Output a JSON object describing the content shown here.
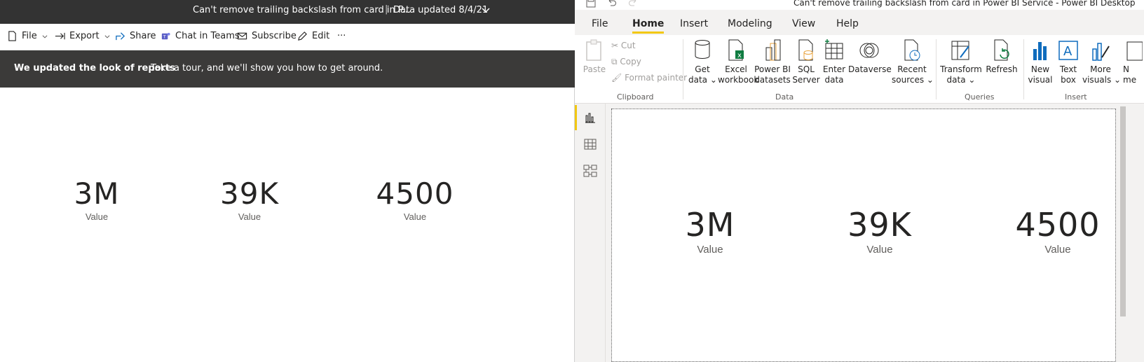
{
  "service": {
    "title_bar": {
      "title": "Can't remove trailing backslash from card in P...",
      "separator": "|",
      "data_updated": "Data updated 8/4/21"
    },
    "toolbar": {
      "file": "File",
      "export": "Export",
      "share": "Share",
      "chat_in_teams": "Chat in Teams",
      "subscribe": "Subscribe",
      "edit": "Edit",
      "more": "···"
    },
    "banner": {
      "bold": "We updated the look of reports",
      "text": "Take a tour, and we'll show you how to get around."
    },
    "cards": [
      {
        "value": "3M",
        "label": "Value"
      },
      {
        "value": "39K",
        "label": "Value"
      },
      {
        "value": "4500",
        "label": "Value"
      }
    ]
  },
  "desktop": {
    "title": "Can't remove trailing backslash from card in Power BI Service - Power BI Desktop",
    "tabs": [
      "File",
      "Home",
      "Insert",
      "Modeling",
      "View",
      "Help"
    ],
    "active_tab": "Home",
    "accent": "#f2c811",
    "ribbon": {
      "clipboard": {
        "paste": "Paste",
        "cut": "Cut",
        "copy": "Copy",
        "format_painter": "Format painter",
        "group": "Clipboard"
      },
      "data": {
        "get_data": [
          "Get",
          "data ⌄"
        ],
        "excel": [
          "Excel",
          "workbook"
        ],
        "pbi_datasets": [
          "Power BI",
          "datasets"
        ],
        "sql": [
          "SQL",
          "Server"
        ],
        "enter": [
          "Enter",
          "data"
        ],
        "dataverse": [
          "Dataverse",
          ""
        ],
        "recent": [
          "Recent",
          "sources ⌄"
        ],
        "group": "Data"
      },
      "queries": {
        "transform": [
          "Transform",
          "data ⌄"
        ],
        "refresh": [
          "Refresh",
          ""
        ],
        "group": "Queries"
      },
      "insert": {
        "new_visual": [
          "New",
          "visual"
        ],
        "text_box": [
          "Text",
          "box"
        ],
        "more_visuals": [
          "More",
          "visuals ⌄"
        ],
        "new_measure": [
          "N",
          "me"
        ],
        "group": "Insert"
      }
    },
    "cards": [
      {
        "value": "3M",
        "label": "Value"
      },
      {
        "value": "39K",
        "label": "Value"
      },
      {
        "value": "4500",
        "label": "Value"
      }
    ]
  }
}
